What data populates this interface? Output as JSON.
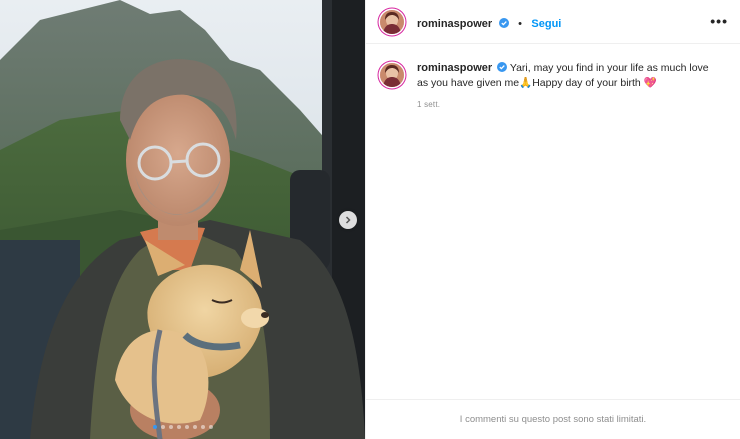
{
  "post": {
    "username": "rominaspower",
    "verified": true,
    "separator": "•",
    "follow_label": "Segui",
    "more_label": "•••",
    "caption_text": "Yari, may you find in your life as much love as you have given me🙏Happy day of your birth 💖",
    "date": "1 sett.",
    "comments_disabled_text": "I commenti su questo post sono stati limitati."
  },
  "media": {
    "carousel_count": 8,
    "carousel_active_index": 0,
    "next_icon": "chevron-right-icon"
  },
  "colors": {
    "follow": "#0095f6",
    "verified": "#3897f0",
    "muted": "#8e8e8e",
    "border": "#efefef"
  }
}
